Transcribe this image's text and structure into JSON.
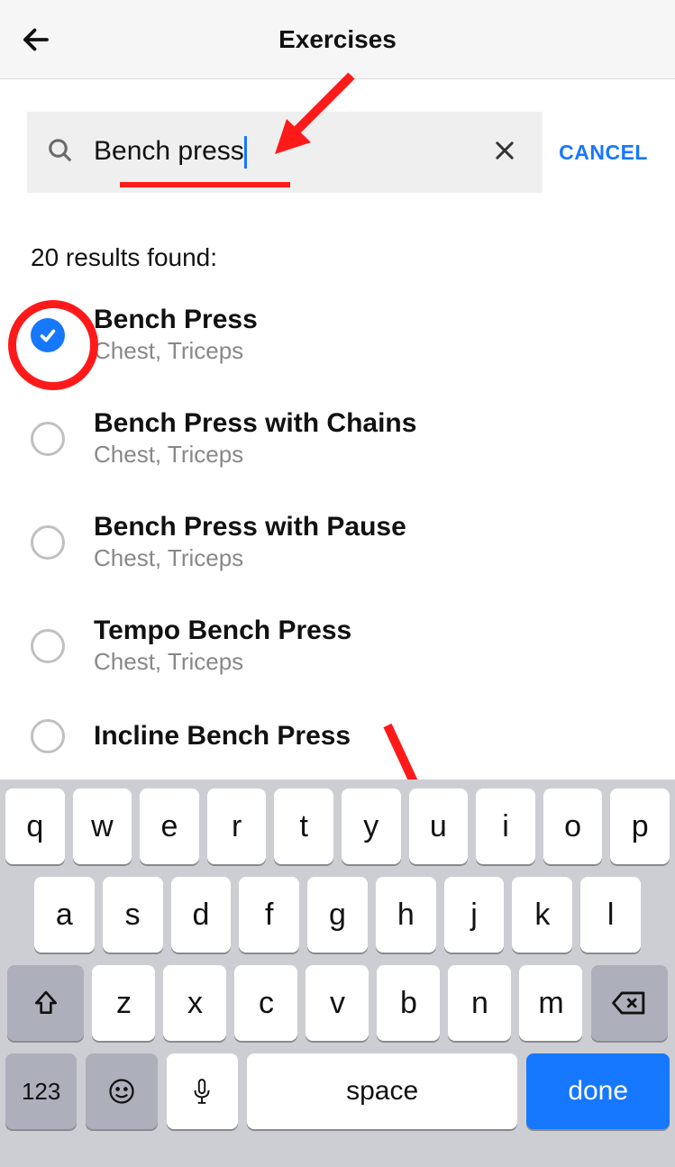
{
  "header": {
    "title": "Exercises"
  },
  "search": {
    "value": "Bench press",
    "cancel": "CANCEL"
  },
  "results": {
    "count_label": "20 results found:",
    "items": [
      {
        "name": "Bench Press",
        "sub": "Chest, Triceps",
        "selected": true
      },
      {
        "name": "Bench Press with Chains",
        "sub": "Chest, Triceps",
        "selected": false
      },
      {
        "name": "Bench Press with Pause",
        "sub": "Chest, Triceps",
        "selected": false
      },
      {
        "name": "Tempo Bench Press",
        "sub": "Chest, Triceps",
        "selected": false
      },
      {
        "name": "Incline Bench Press",
        "sub": "",
        "selected": false
      }
    ]
  },
  "keyboard": {
    "row1": [
      "q",
      "w",
      "e",
      "r",
      "t",
      "y",
      "u",
      "i",
      "o",
      "p"
    ],
    "row2": [
      "a",
      "s",
      "d",
      "f",
      "g",
      "h",
      "j",
      "k",
      "l"
    ],
    "row3": [
      "z",
      "x",
      "c",
      "v",
      "b",
      "n",
      "m"
    ],
    "sym": "123",
    "space": "space",
    "done": "done"
  }
}
